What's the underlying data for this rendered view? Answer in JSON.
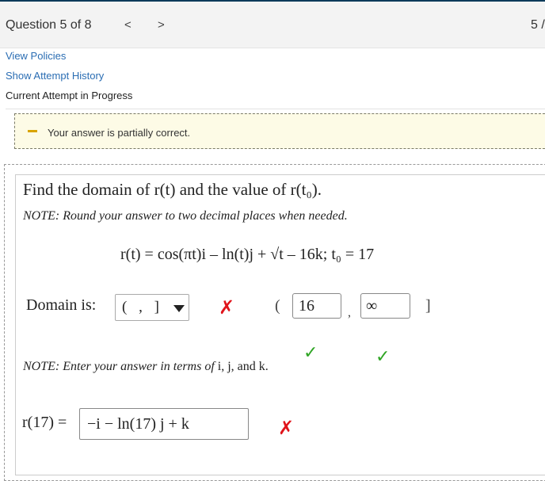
{
  "header": {
    "question_label": "Question 5 of 8",
    "prev_symbol": "<",
    "next_symbol": ">",
    "page_count": "5 /"
  },
  "links": {
    "view_policies": "View Policies",
    "show_attempt_history": "Show Attempt History"
  },
  "current_attempt": "Current Attempt in Progress",
  "status": {
    "message": "Your answer is partially correct.",
    "color": "#d9a400"
  },
  "question": {
    "prompt": "Find the domain of r(t) and the value of r(t₀).",
    "note_round": "NOTE: Round your answer to two decimal places when needed.",
    "equation": "r(t) = cos(πt)i – ln(t)j + √t – 16k; t₀ = 17",
    "domain_label": "Domain is:",
    "domain_select_value": "( , ]",
    "interval_open": "(",
    "interval_lower": "16",
    "interval_comma": ",",
    "interval_upper": "∞",
    "interval_close": "]",
    "note_terms_prefix": "NOTE: Enter your answer in terms of",
    "note_terms_vars": "i, j, and k.",
    "r17_label": "r(17) =",
    "r17_value": "−i − ln(17) j + k"
  },
  "marks": {
    "incorrect": "✗",
    "correct": "✓",
    "incorrect_color": "#e0141b",
    "correct_color": "#2fa524"
  }
}
